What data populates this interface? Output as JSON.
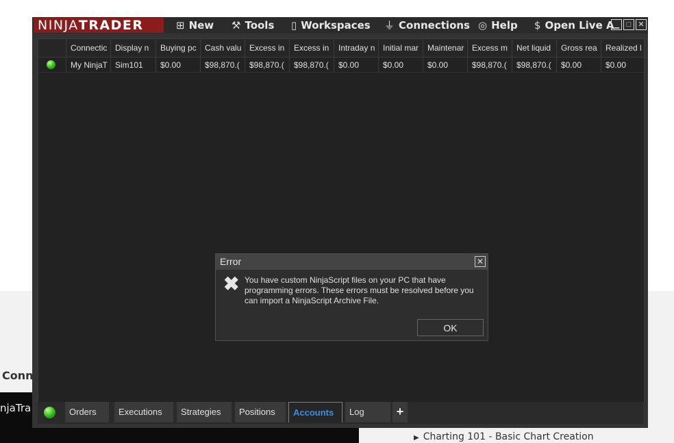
{
  "background": {
    "heading": "Conn",
    "video_text": "njaTra",
    "link": "Charting 101 - Basic Chart Creation"
  },
  "titlebar": {
    "logo_part1": "NINJA",
    "logo_part2": "TRADER",
    "menu": [
      {
        "label": "New",
        "icon": "new-document-icon"
      },
      {
        "label": "Tools",
        "icon": "wrench-icon"
      },
      {
        "label": "Workspaces",
        "icon": "document-icon"
      },
      {
        "label": "Connections",
        "icon": "plug-icon"
      },
      {
        "label": "Help",
        "icon": "lifebuoy-icon"
      },
      {
        "label": "Open Live A",
        "icon": "dollar-icon"
      }
    ]
  },
  "grid": {
    "columns": [
      "Connectic",
      "Display n",
      "Buying pc",
      "Cash valu",
      "Excess in",
      "Excess in",
      "Intraday n",
      "Initial mar",
      "Maintenar",
      "Excess m",
      "Net liquid",
      "Gross rea",
      "Realized l"
    ],
    "rows": [
      [
        "My NinjaT",
        "Sim101",
        "$0.00",
        "$98,870.(",
        "$98,870.(",
        "$98,870.(",
        "$0.00",
        "$0.00",
        "$0.00",
        "$98,870.(",
        "$98,870.(",
        "$0.00",
        "$0.00"
      ]
    ],
    "status_color": "#2fb51a"
  },
  "tabs": {
    "items": [
      "Orders",
      "Executions",
      "Strategies",
      "Positions",
      "Accounts",
      "Log"
    ],
    "active": "Accounts",
    "add_label": "+"
  },
  "dialog": {
    "title": "Error",
    "message": "You have custom NinjaScript files on your PC that have programming errors. These errors must be resolved before you can import a NinjaScript Archive File.",
    "ok_label": "OK"
  },
  "colors": {
    "brand": "#8a1c1c",
    "accent": "#3b8fe0",
    "window_bg": "#333333",
    "grid_bg": "#222222"
  }
}
